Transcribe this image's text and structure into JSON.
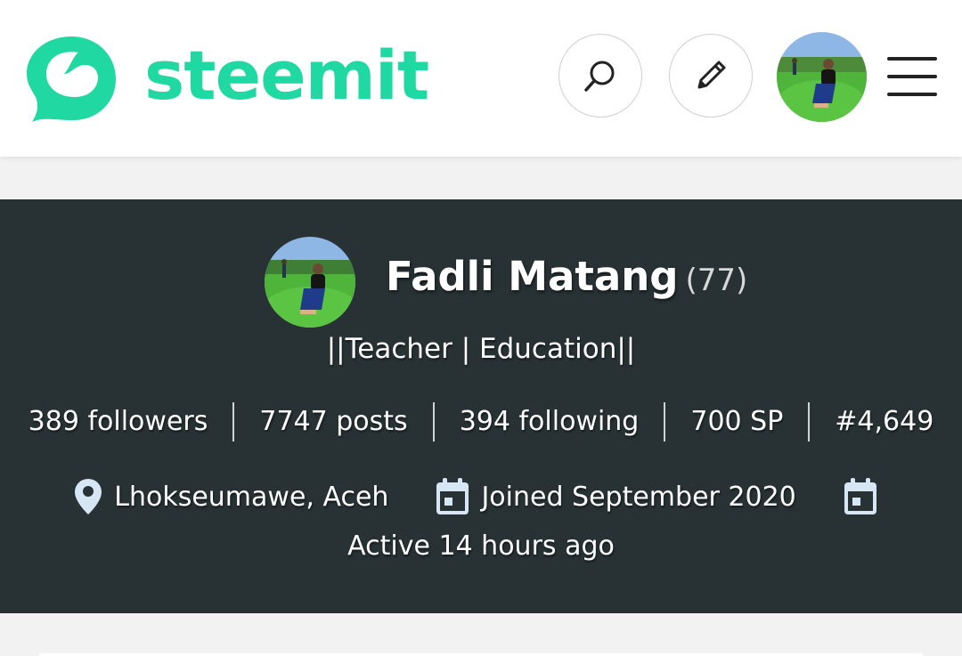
{
  "app": {
    "logo_text": "steemit",
    "brand_color": "#1fd8a2"
  },
  "header": {
    "search_icon": "search-icon",
    "edit_icon": "pencil-icon",
    "menu_icon": "hamburger-menu-icon"
  },
  "profile": {
    "name": "Fadli Matang",
    "reputation": "(77)",
    "about": "||Teacher | Education||",
    "stats": {
      "followers": "389 followers",
      "posts": "7747 posts",
      "following": "394 following",
      "sp": "700 SP",
      "rank": "#4,649"
    },
    "location": "Lhokseumawe, Aceh",
    "joined": "Joined September 2020",
    "active": "Active 14 hours ago"
  },
  "colors": {
    "banner_bg": "#283234",
    "page_bg": "#f2f2f2",
    "icon_light": "#d7e6f5"
  }
}
